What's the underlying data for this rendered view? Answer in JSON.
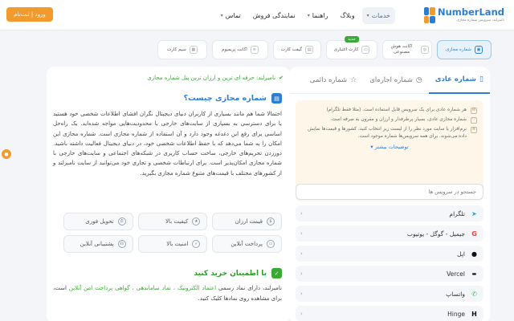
{
  "header": {
    "logo_name": "NumberLand",
    "logo_tagline": "نامبرلند، سرویس شماره مجازی",
    "nav": [
      {
        "label": "خدمات",
        "has_menu": true,
        "active": true
      },
      {
        "label": "وبلاگ",
        "has_menu": false,
        "active": false
      },
      {
        "label": "راهنما",
        "has_menu": true,
        "active": false
      },
      {
        "label": "نمایندگی فروش",
        "has_menu": false,
        "active": false
      },
      {
        "label": "تماس",
        "has_menu": true,
        "active": false
      }
    ],
    "login_label": "ورود | ثبت‌نام"
  },
  "service_tabs": [
    {
      "label": "شماره مجازی",
      "active": true,
      "badge": ""
    },
    {
      "label": "اکانت هوش مصنوعی",
      "active": false,
      "badge": ""
    },
    {
      "label": "کارت اعتباری",
      "active": false,
      "badge": "جدید"
    },
    {
      "label": "گیفت کارت",
      "active": false,
      "badge": ""
    },
    {
      "label": "اکانت پریمیوم",
      "active": false,
      "badge": ""
    },
    {
      "label": "سیم کارت",
      "active": false,
      "badge": ""
    }
  ],
  "number_tabs": [
    {
      "label": "شماره عادی",
      "active": true,
      "icon": "phone-icon"
    },
    {
      "label": "شماره اجاره‌ای",
      "active": false,
      "icon": "clock-icon"
    },
    {
      "label": "شماره دائمی",
      "active": false,
      "icon": "star-icon"
    }
  ],
  "info_box": {
    "lines": [
      "هر شماره عادی برای یک سرویس قابل استفاده است. (مثلا فقط تلگرام)",
      "شماره مجازی عادی، بسیار پرطرفدار و ارزان و مقرون به صرفه است.",
      "نرم‌افزار یا سایت مورد نظر را از لیست زیر انتخاب کنید، کشورها و قیمت‌ها نمایش داده می‌شوند. برای همه سرویس‌ها شماره موجود است."
    ],
    "more_label": "توضیحات بیشتر"
  },
  "search": {
    "placeholder": "جستجو در سرویس ها"
  },
  "services": [
    {
      "name": "تلگرام",
      "icon": "telegram-icon",
      "color": "#2aa3df"
    },
    {
      "name": "جیمیل - گوگل - یوتیوب",
      "icon": "google-icon",
      "color": "#ea4335"
    },
    {
      "name": "اپل",
      "icon": "apple-icon",
      "color": "#111111"
    },
    {
      "name": "Vercel",
      "icon": "vercel-icon",
      "color": "#111111"
    },
    {
      "name": "واتساپ",
      "icon": "whatsapp-icon",
      "color": "#25d366"
    },
    {
      "name": "Hinge",
      "icon": "hinge-icon",
      "color": "#111111"
    }
  ],
  "content": {
    "tagline": "نامبرلند: حرفه ای ترین و ارزان ترین پنل شماره مجازی",
    "heading": "شماره مجازی چیست؟",
    "paragraph": "احتمالا شما هم مانند بسیاری از کاربران دنیای دیجیتال نگران افشای اطلاعات شخصی خود هستید یا برای دسترسی به بسیاری از سایت‌های خارجی با محدودیت‌هایی مواجه شده‌اید. یک راه‌حل اساسی برای رفع این دغدغه وجود دارد و آن استفاده از شماره مجازی است. شماره مجازی این امکان را به شما می‌دهد که با حفظ اطلاعات شخصی خود، در دنیای دیجیتال فعالیت داشته باشید. دورزدن تحریم‌های خارجی، ساخت حساب کاربری در شبکه‌های اجتماعی و سایت‌های خارجی با شماره مجازی امکان‌پذیر است. برای ارتباطات شخصی و تجاری خود می‌توانید از سایت نامبرلند و از کشورهای مختلف با قیمت‌های متنوع شماره مجازی بگیرید.",
    "features": [
      {
        "label": "قیمت ارزان",
        "icon": "price-icon"
      },
      {
        "label": "کیفیت بالا",
        "icon": "quality-icon"
      },
      {
        "label": "تحویل فوری",
        "icon": "delivery-icon"
      },
      {
        "label": "پرداخت آنلاین",
        "icon": "card-icon"
      },
      {
        "label": "امنیت بالا",
        "icon": "shield-icon"
      },
      {
        "label": "پشتیبانی آنلاین",
        "icon": "support-icon"
      }
    ],
    "heading2": "با اطمینان خرید کنید",
    "paragraph2_pre": "نامبرلند، دارای نماد رسمی ",
    "paragraph2_links": "اعتماد الکترونیک ، نماد ساماندهی ، گواهی پرداخت امن آنلاین",
    "paragraph2_post": " است، برای مشاهده روی نمادها کلیک کنید."
  }
}
